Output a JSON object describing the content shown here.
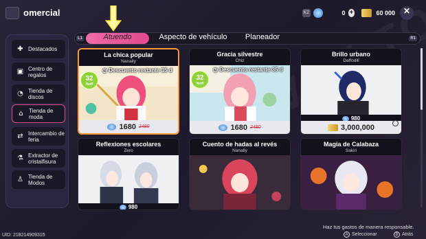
{
  "header": {
    "title": "omercial",
    "level_badge": "K2",
    "gem_amount": "0",
    "ticket_amount": "60 000",
    "close_symbol": "✕"
  },
  "tabs": {
    "left_hint": "L1",
    "right_hint": "R1",
    "items": [
      {
        "label": "Atuendo",
        "active": true
      },
      {
        "label": "Aspecto de vehículo",
        "active": false
      },
      {
        "label": "Planeador",
        "active": false
      }
    ]
  },
  "sidebar": {
    "items": [
      {
        "label": "Destacados",
        "icon": "star-box-icon",
        "glyph": "✚"
      },
      {
        "label": "Centro de regalos",
        "icon": "gift-icon",
        "glyph": "▣"
      },
      {
        "label": "Tienda de discos",
        "icon": "disc-icon",
        "glyph": "◔"
      },
      {
        "label": "Tienda de moda",
        "icon": "hanger-icon",
        "glyph": "⌂",
        "active": true
      },
      {
        "label": "Intercambio de feria",
        "icon": "exchange-icon",
        "glyph": "⇄"
      },
      {
        "label": "Extractor de cristalfisura",
        "icon": "flask-icon",
        "glyph": "⚗"
      },
      {
        "label": "Tienda de Modos",
        "icon": "mode-icon",
        "glyph": "♙"
      }
    ]
  },
  "cards": [
    {
      "title": "La chica popular",
      "subtitle": "Nanally",
      "price": "1680",
      "old_price": "2480",
      "currency": "gem",
      "discount_badge": "32",
      "discount_unit": "%off",
      "discount_text": "Descuento restante 35 d",
      "selected": true
    },
    {
      "title": "Gracia silvestre",
      "subtitle": "Chiz",
      "price": "1680",
      "old_price": "2480",
      "currency": "gem",
      "discount_badge": "32",
      "discount_unit": "%off",
      "discount_text": "Descuento restante 35 d",
      "selected": false
    },
    {
      "title": "Brillo urbano",
      "subtitle": "Daffodill",
      "price": "980",
      "price2": "3,000,000",
      "currency": "gem+ticket",
      "selected": false
    },
    {
      "title": "Reflexiones escolares",
      "subtitle": "Zero",
      "price": "980",
      "currency": "gem",
      "selected": false
    },
    {
      "title": "Cuento de hadas al revés",
      "subtitle": "Nanally",
      "currency": "none",
      "selected": false
    },
    {
      "title": "Magia de Calabaza",
      "subtitle": "Sakiri",
      "currency": "none",
      "selected": false
    }
  ],
  "footer": {
    "uid": "UID: 218214909315",
    "responsible": "Haz tus gastos de manera responsable.",
    "select_button": "A",
    "select_label": "Seleccionar",
    "back_button": "B",
    "back_label": "Atrás"
  },
  "watermark": "EVEN TO",
  "colors": {
    "accent_pink": "#e24a8e",
    "selected_border": "#ff9a3a",
    "discount_green": "#8fd13a",
    "old_price_red": "#c23a4a"
  }
}
